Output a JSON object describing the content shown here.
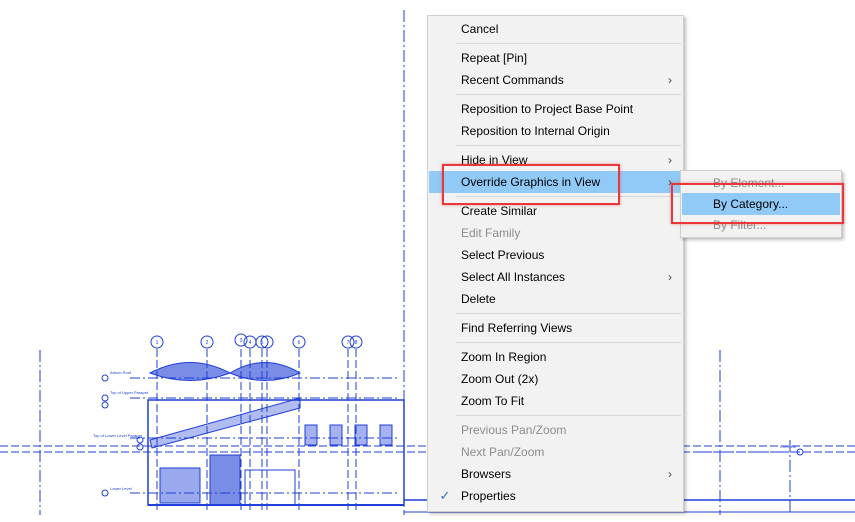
{
  "colors": {
    "drawing_blue": "#1f3fd6",
    "menu_bg": "#f2f2f2",
    "highlight": "#91c9f7",
    "callout_red": "#e8383b"
  },
  "drawing": {
    "grid_bubbles": [
      "1",
      "2",
      "3",
      "4",
      "5",
      "6",
      "7",
      "8"
    ],
    "level_labels": [
      "Atrium Roof",
      "Top of Upper Parapet",
      "Top of Lower Level Parapet",
      "Lower Level",
      "Concrete"
    ]
  },
  "context_menu": {
    "cancel": "Cancel",
    "repeat": "Repeat [Pin]",
    "recent_commands": "Recent Commands",
    "reposition_base": "Reposition to Project Base Point",
    "reposition_internal": "Reposition to Internal Origin",
    "hide_in_view": "Hide in View",
    "override_graphics": "Override Graphics in View",
    "create_similar": "Create Similar",
    "edit_family": "Edit Family",
    "select_previous": "Select Previous",
    "select_all_instances": "Select All Instances",
    "delete": "Delete",
    "find_referring": "Find Referring Views",
    "zoom_in_region": "Zoom In Region",
    "zoom_out": "Zoom Out (2x)",
    "zoom_to_fit": "Zoom To Fit",
    "previous_pan_zoom": "Previous Pan/Zoom",
    "next_pan_zoom": "Next Pan/Zoom",
    "browsers": "Browsers",
    "properties": "Properties",
    "submenu_arrow": "›",
    "checkmark": "✓"
  },
  "submenu": {
    "by_element": "By Element...",
    "by_category": "By Category...",
    "by_filter": "By Filter..."
  }
}
